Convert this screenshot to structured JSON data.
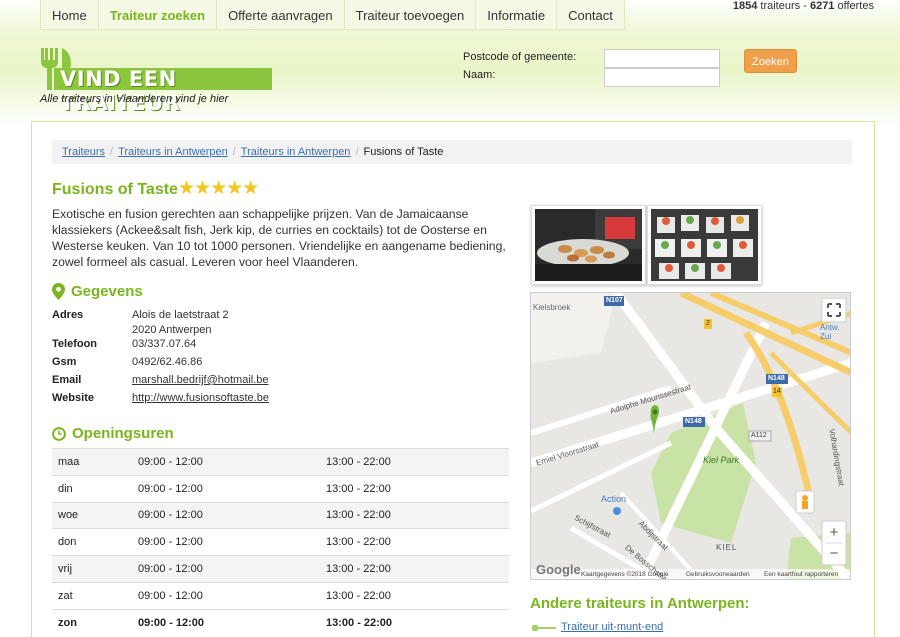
{
  "nav": {
    "items": [
      "Home",
      "Traiteur zoeken",
      "Offerte aanvragen",
      "Traiteur toevoegen",
      "Informatie",
      "Contact"
    ],
    "active_index": 1
  },
  "stats": {
    "traiteurs": "1854",
    "traiteurs_label": "traiteurs",
    "sep": "-",
    "offertes": "6271",
    "offertes_label": "offertes"
  },
  "logo": {
    "text": "VIND EEN TRAITEUR",
    "tagline": "Alle traiteurs in Vlaanderen vind je hier"
  },
  "search": {
    "postcode_label": "Postcode of gemeente:",
    "name_label": "Naam:",
    "postcode_value": "",
    "name_value": "",
    "button": "Zoeken"
  },
  "breadcrumb": {
    "items": [
      "Traiteurs",
      "Traiteurs in Antwerpen",
      "Traiteurs in Antwerpen"
    ],
    "current": "Fusions of Taste"
  },
  "business": {
    "name": "Fusions of Taste",
    "rating": 5,
    "stars": "★★★★★",
    "description": "Exotische en fusion gerechten aan schappelijke prijzen. Van de Jamaicaanse klassiekers (Ackee&salt fish, Jerk kip, de curries en cocktails) tot de Oosterse en Westerse keuken. Van 10 tot 1000 personen. Vriendelijke en aangename bediening, zowel formeel als casual. Leveren voor heel Vlaanderen."
  },
  "details": {
    "title": "Gegevens",
    "address_label": "Adres",
    "address_line1": "Alois de laetstraat 2",
    "address_line2": "2020 Antwerpen",
    "phone_label": "Telefoon",
    "phone": "03/337.07.64",
    "mobile_label": "Gsm",
    "mobile": "0492/62.46.86",
    "email_label": "Email",
    "email": "marshall.bedrijf@hotmail.be",
    "website_label": "Website",
    "website": "http://www.fusionsoftaste.be"
  },
  "hours": {
    "title": "Openingsuren",
    "rows": [
      {
        "day": "maa",
        "morning": "09:00 - 12:00",
        "evening": "13:00 - 22:00"
      },
      {
        "day": "din",
        "morning": "09:00 - 12:00",
        "evening": "13:00 - 22:00"
      },
      {
        "day": "woe",
        "morning": "09:00 - 12:00",
        "evening": "13:00 - 22:00"
      },
      {
        "day": "don",
        "morning": "09:00 - 12:00",
        "evening": "13:00 - 22:00"
      },
      {
        "day": "vrij",
        "morning": "09:00 - 12:00",
        "evening": "13:00 - 22:00"
      },
      {
        "day": "zat",
        "morning": "09:00 - 12:00",
        "evening": "13:00 - 22:00"
      },
      {
        "day": "zon",
        "morning": "09:00 - 12:00",
        "evening": "13:00 - 22:00"
      }
    ]
  },
  "map": {
    "labels": {
      "kielsbroek": "Kielsbroek",
      "n107": "N107",
      "antw_zuid": "Antw. Zui",
      "n148a": "N148",
      "n148b": "N148",
      "adolphe": "Adolphe Mourissestraat",
      "vloors": "Emiel Vloorsstraat",
      "kielpark": "Kiel Park",
      "a112": "A112",
      "action": "Action",
      "schijf": "Schijfstraat",
      "abdij": "Abdijstraat",
      "bosch": "De Bosschstraat",
      "kiel": "KIEL",
      "volhard": "Volhardingstraat",
      "r14": "14",
      "r2": "2"
    },
    "google": "Google",
    "attribution": [
      "Kaartgegevens ©2018 Google",
      "Gebruiksvoorwaarden",
      "Een kaartfout rapporteren"
    ],
    "zoom_in": "+",
    "zoom_out": "−"
  },
  "other": {
    "title": "Andere traiteurs in Antwerpen:",
    "links": [
      "Traiteur uit-munt-end"
    ]
  },
  "colors": {
    "brand_green": "#7ab51d",
    "button_orange": "#f0a04b",
    "star": "#f5c518",
    "link": "#3a6fb0"
  }
}
